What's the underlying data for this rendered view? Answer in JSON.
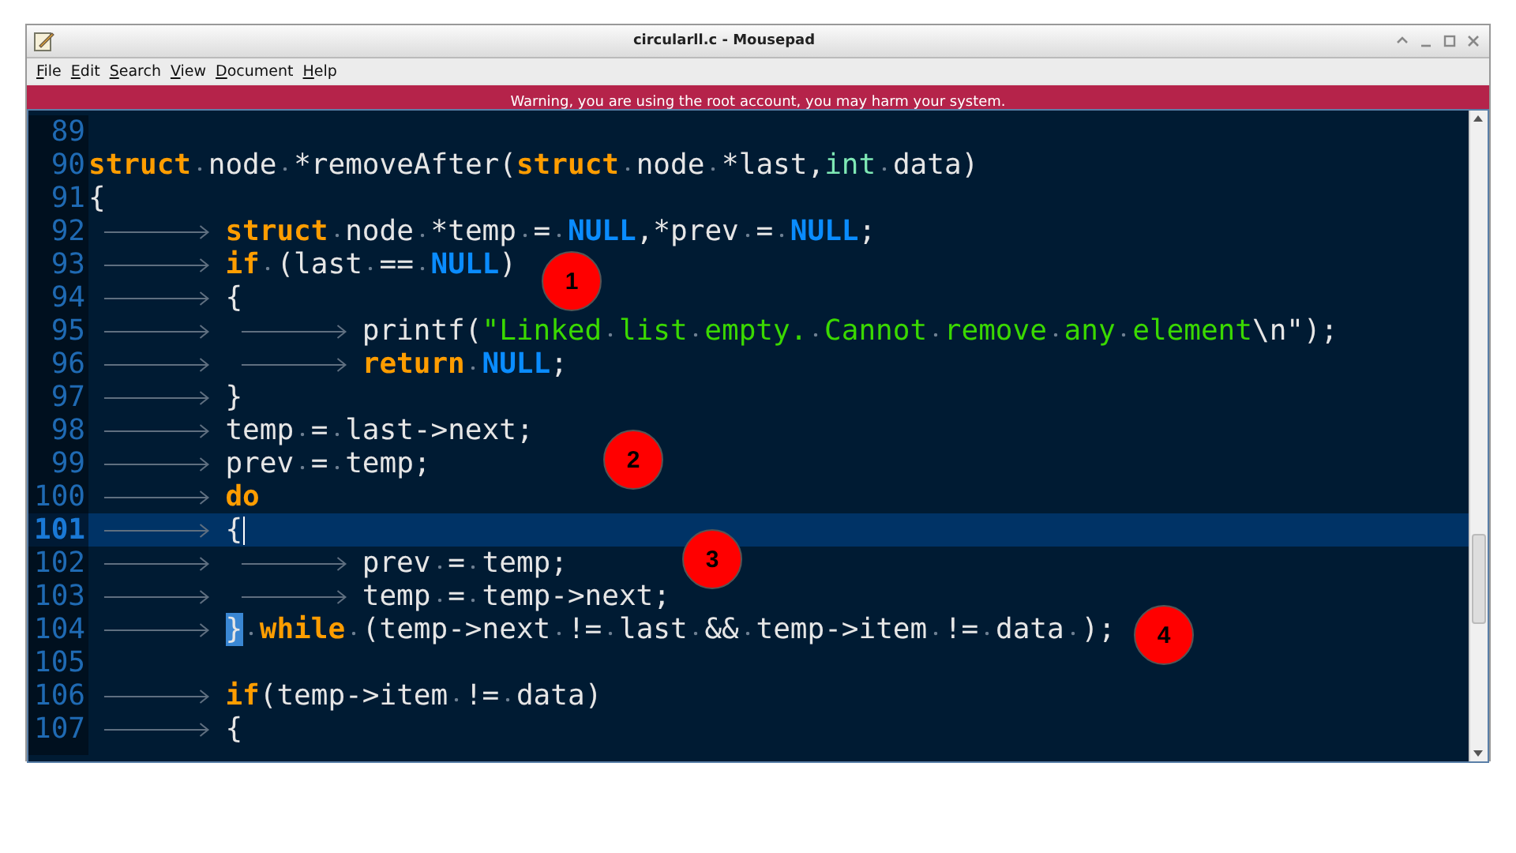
{
  "window": {
    "title": "circularll.c - Mousepad"
  },
  "menu": [
    "File",
    "Edit",
    "Search",
    "View",
    "Document",
    "Help"
  ],
  "warning": "Warning, you are using the root account, you may harm your system.",
  "editor": {
    "lines": [
      {
        "number": "89",
        "current": false
      },
      {
        "number": "90",
        "current": false,
        "tokens": [
          {
            "kind": "keyword",
            "text": "struct"
          },
          {
            "kind": "plain",
            "text": " node *removeAfter("
          },
          {
            "kind": "keyword",
            "text": "struct"
          },
          {
            "kind": "plain",
            "text": " node *last,"
          },
          {
            "kind": "type",
            "text": "int"
          },
          {
            "kind": "plain",
            "text": " data)"
          }
        ]
      },
      {
        "number": "91",
        "current": false,
        "tokens": [
          {
            "kind": "plain",
            "text": "{"
          }
        ]
      },
      {
        "number": "92",
        "current": false,
        "tokens": [
          {
            "kind": "tab"
          },
          {
            "kind": "keyword",
            "text": "struct"
          },
          {
            "kind": "plain",
            "text": " node *temp = "
          },
          {
            "kind": "constant",
            "text": "NULL"
          },
          {
            "kind": "plain",
            "text": ",*prev = "
          },
          {
            "kind": "constant",
            "text": "NULL"
          },
          {
            "kind": "plain",
            "text": ";"
          }
        ]
      },
      {
        "number": "93",
        "current": false,
        "tokens": [
          {
            "kind": "tab"
          },
          {
            "kind": "keyword",
            "text": "if"
          },
          {
            "kind": "plain",
            "text": " (last == "
          },
          {
            "kind": "constant",
            "text": "NULL"
          },
          {
            "kind": "plain",
            "text": ")"
          }
        ]
      },
      {
        "number": "94",
        "current": false,
        "tokens": [
          {
            "kind": "tab"
          },
          {
            "kind": "plain",
            "text": "{"
          }
        ]
      },
      {
        "number": "95",
        "current": false,
        "tokens": [
          {
            "kind": "tab"
          },
          {
            "kind": "tab"
          },
          {
            "kind": "plain",
            "text": "printf("
          },
          {
            "kind": "string",
            "text": "\"Linked list empty. Cannot remove any element"
          },
          {
            "kind": "plain",
            "text": "\\n\");"
          }
        ]
      },
      {
        "number": "96",
        "current": false,
        "tokens": [
          {
            "kind": "tab"
          },
          {
            "kind": "tab"
          },
          {
            "kind": "keyword",
            "text": "return"
          },
          {
            "kind": "constant",
            "text": " NULL"
          },
          {
            "kind": "plain",
            "text": ";"
          }
        ]
      },
      {
        "number": "97",
        "current": false,
        "tokens": [
          {
            "kind": "tab"
          },
          {
            "kind": "plain",
            "text": "}"
          }
        ]
      },
      {
        "number": "98",
        "current": false,
        "tokens": [
          {
            "kind": "tab"
          },
          {
            "kind": "plain",
            "text": "temp = last->next;"
          }
        ]
      },
      {
        "number": "99",
        "current": false,
        "tokens": [
          {
            "kind": "tab"
          },
          {
            "kind": "plain",
            "text": "prev = temp;"
          }
        ]
      },
      {
        "number": "100",
        "current": false,
        "tokens": [
          {
            "kind": "tab"
          },
          {
            "kind": "keyword",
            "text": "do"
          }
        ]
      },
      {
        "number": "101",
        "current": true,
        "tokens": [
          {
            "kind": "tab"
          },
          {
            "kind": "plain",
            "text": "{"
          },
          {
            "kind": "cursor"
          }
        ]
      },
      {
        "number": "102",
        "current": false,
        "tokens": [
          {
            "kind": "tab"
          },
          {
            "kind": "tab"
          },
          {
            "kind": "plain",
            "text": "prev = temp;"
          }
        ]
      },
      {
        "number": "103",
        "current": false,
        "tokens": [
          {
            "kind": "tab"
          },
          {
            "kind": "tab"
          },
          {
            "kind": "plain",
            "text": "temp = temp->next;"
          }
        ]
      },
      {
        "number": "104",
        "current": false,
        "tokens": [
          {
            "kind": "tab"
          },
          {
            "kind": "bracket-match",
            "text": "}"
          },
          {
            "kind": "keyword",
            "text": " while"
          },
          {
            "kind": "plain",
            "text": " (temp->next != last && temp->item != data );"
          }
        ]
      },
      {
        "number": "105",
        "current": false
      },
      {
        "number": "106",
        "current": false,
        "tokens": [
          {
            "kind": "tab"
          },
          {
            "kind": "keyword",
            "text": "if"
          },
          {
            "kind": "plain",
            "text": "(temp->item != data)"
          }
        ]
      },
      {
        "number": "107",
        "current": false,
        "tokens": [
          {
            "kind": "tab"
          },
          {
            "kind": "plain",
            "text": "{"
          }
        ]
      }
    ]
  },
  "callouts": [
    {
      "label": "1"
    },
    {
      "label": "2"
    },
    {
      "label": "3"
    },
    {
      "label": "4"
    }
  ]
}
